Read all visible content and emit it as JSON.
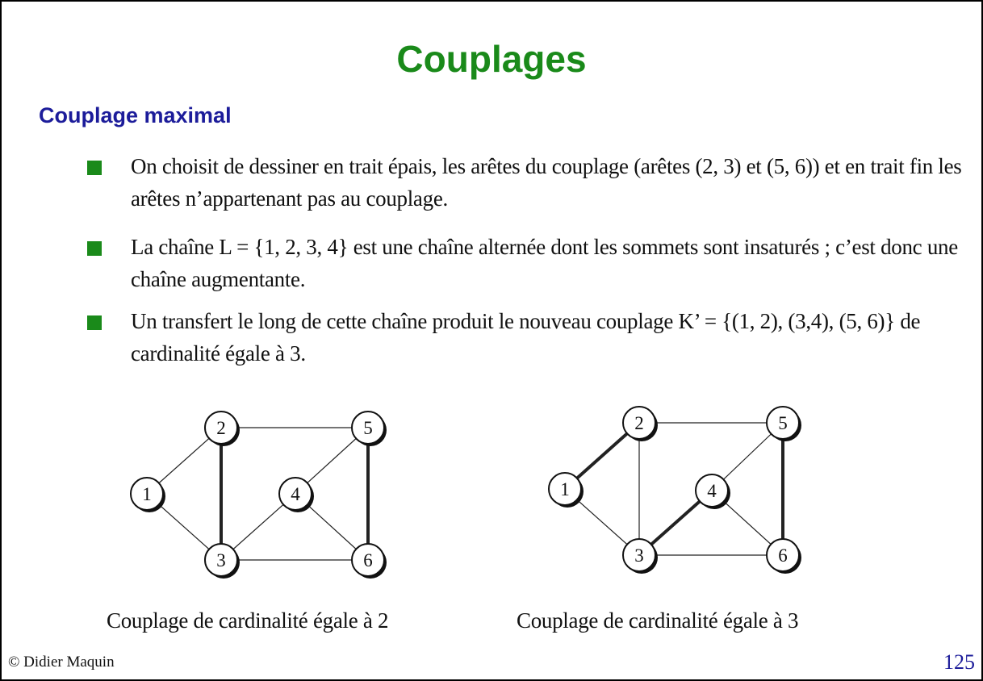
{
  "slide": {
    "title": "Couplages",
    "subtitle": "Couplage maximal",
    "bullets": [
      "On choisit de dessiner en trait épais, les arêtes du couplage (arêtes (2, 3) et (5, 6)) et en trait fin les arêtes n’appartenant pas au couplage.",
      "La chaîne L = {1, 2, 3, 4} est une chaîne alternée dont les sommets sont insaturés ; c’est donc une chaîne augmentante.",
      "Un transfert le long de cette chaîne produit le nouveau couplage K’ = {(1, 2), (3,4), (5, 6)} de cardinalité égale à 3."
    ],
    "captions": [
      "Couplage de cardinalité égale à 2",
      "Couplage de cardinalité égale à 3"
    ],
    "footer_left": "© Didier Maquin",
    "page_number": "125"
  },
  "colors": {
    "title": "#1a8a1a",
    "subtitle": "#1c1c9a",
    "bullet_square": "#1a8a1a"
  },
  "graphs": [
    {
      "nodes": [
        {
          "id": "1",
          "label": "1"
        },
        {
          "id": "2",
          "label": "2"
        },
        {
          "id": "3",
          "label": "3"
        },
        {
          "id": "4",
          "label": "4"
        },
        {
          "id": "5",
          "label": "5"
        },
        {
          "id": "6",
          "label": "6"
        }
      ],
      "edges": [
        {
          "from": "1",
          "to": "2",
          "matched": false
        },
        {
          "from": "1",
          "to": "3",
          "matched": false
        },
        {
          "from": "2",
          "to": "3",
          "matched": true
        },
        {
          "from": "2",
          "to": "5",
          "matched": false
        },
        {
          "from": "3",
          "to": "4",
          "matched": false
        },
        {
          "from": "3",
          "to": "6",
          "matched": false
        },
        {
          "from": "4",
          "to": "5",
          "matched": false
        },
        {
          "from": "4",
          "to": "6",
          "matched": false
        },
        {
          "from": "5",
          "to": "6",
          "matched": true
        }
      ]
    },
    {
      "nodes": [
        {
          "id": "1",
          "label": "1"
        },
        {
          "id": "2",
          "label": "2"
        },
        {
          "id": "3",
          "label": "3"
        },
        {
          "id": "4",
          "label": "4"
        },
        {
          "id": "5",
          "label": "5"
        },
        {
          "id": "6",
          "label": "6"
        }
      ],
      "edges": [
        {
          "from": "1",
          "to": "2",
          "matched": true
        },
        {
          "from": "1",
          "to": "3",
          "matched": false
        },
        {
          "from": "2",
          "to": "3",
          "matched": false
        },
        {
          "from": "2",
          "to": "5",
          "matched": false
        },
        {
          "from": "3",
          "to": "4",
          "matched": true
        },
        {
          "from": "3",
          "to": "6",
          "matched": false
        },
        {
          "from": "4",
          "to": "5",
          "matched": false
        },
        {
          "from": "4",
          "to": "6",
          "matched": false
        },
        {
          "from": "5",
          "to": "6",
          "matched": true
        }
      ]
    }
  ]
}
